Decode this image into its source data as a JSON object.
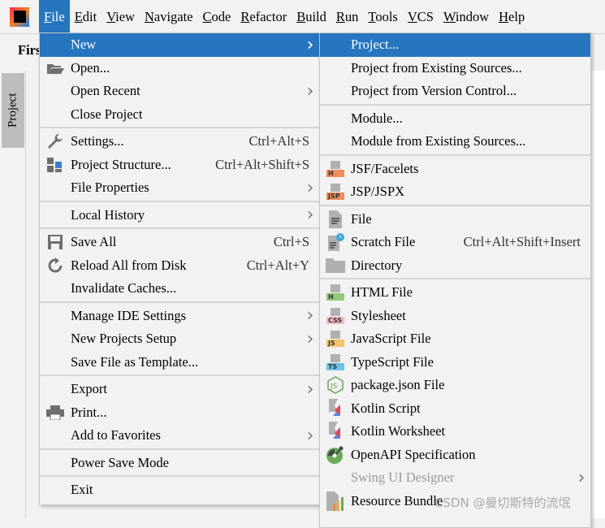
{
  "menubar": {
    "items": [
      "File",
      "Edit",
      "View",
      "Navigate",
      "Code",
      "Refactor",
      "Build",
      "Run",
      "Tools",
      "VCS",
      "Window",
      "Help"
    ],
    "active": "File"
  },
  "breadcrumb": "Firs",
  "tool_window": {
    "project_tab": "Project"
  },
  "file_menu": [
    {
      "label": "New",
      "arrow": true,
      "selected": true
    },
    {
      "label": "Open...",
      "icon": "folder-open-icon"
    },
    {
      "label": "Open Recent",
      "arrow": true
    },
    {
      "label": "Close Project"
    },
    {
      "sep": true
    },
    {
      "label": "Settings...",
      "icon": "wrench-icon",
      "shortcut": "Ctrl+Alt+S"
    },
    {
      "label": "Project Structure...",
      "icon": "project-structure-icon",
      "shortcut": "Ctrl+Alt+Shift+S"
    },
    {
      "label": "File Properties",
      "arrow": true
    },
    {
      "sep": true
    },
    {
      "label": "Local History",
      "arrow": true
    },
    {
      "sep": true
    },
    {
      "label": "Save All",
      "icon": "save-icon",
      "shortcut": "Ctrl+S"
    },
    {
      "label": "Reload All from Disk",
      "icon": "reload-icon",
      "shortcut": "Ctrl+Alt+Y"
    },
    {
      "label": "Invalidate Caches..."
    },
    {
      "sep": true
    },
    {
      "label": "Manage IDE Settings",
      "arrow": true
    },
    {
      "label": "New Projects Setup",
      "arrow": true
    },
    {
      "label": "Save File as Template..."
    },
    {
      "sep": true
    },
    {
      "label": "Export",
      "arrow": true
    },
    {
      "label": "Print...",
      "icon": "printer-icon"
    },
    {
      "label": "Add to Favorites",
      "arrow": true
    },
    {
      "sep": true
    },
    {
      "label": "Power Save Mode"
    },
    {
      "sep": true
    },
    {
      "label": "Exit"
    }
  ],
  "new_submenu": [
    {
      "label": "Project...",
      "selected": true
    },
    {
      "label": "Project from Existing Sources..."
    },
    {
      "label": "Project from Version Control..."
    },
    {
      "sep": true
    },
    {
      "label": "Module..."
    },
    {
      "label": "Module from Existing Sources..."
    },
    {
      "sep": true
    },
    {
      "label": "JSF/Facelets",
      "icon": "jsf-file-icon",
      "badge": "H",
      "badge_color": "#f28c5c"
    },
    {
      "label": "JSP/JSPX",
      "icon": "jsp-file-icon",
      "badge": "JSP",
      "badge_color": "#f28c5c"
    },
    {
      "sep": true
    },
    {
      "label": "File",
      "icon": "file-icon"
    },
    {
      "label": "Scratch File",
      "icon": "scratch-file-icon",
      "shortcut": "Ctrl+Alt+Shift+Insert"
    },
    {
      "label": "Directory",
      "icon": "directory-icon"
    },
    {
      "sep": true
    },
    {
      "label": "HTML File",
      "icon": "html-file-icon",
      "badge": "H",
      "badge_color": "#8fc97a"
    },
    {
      "label": "Stylesheet",
      "icon": "css-file-icon",
      "badge": "CSS",
      "badge_color": "#f5b8c4"
    },
    {
      "label": "JavaScript File",
      "icon": "js-file-icon",
      "badge": "JS",
      "badge_color": "#f5c46e"
    },
    {
      "label": "TypeScript File",
      "icon": "ts-file-icon",
      "badge": "TS",
      "badge_color": "#6cc4ea"
    },
    {
      "label": "package.json File",
      "icon": "nodejs-icon"
    },
    {
      "label": "Kotlin Script",
      "icon": "kotlin-icon"
    },
    {
      "label": "Kotlin Worksheet",
      "icon": "kotlin-icon"
    },
    {
      "label": "OpenAPI Specification",
      "icon": "openapi-icon"
    },
    {
      "label": "Swing UI Designer",
      "arrow": true,
      "disabled": true
    },
    {
      "label": "Resource Bundle",
      "icon": "resource-bundle-icon"
    }
  ],
  "watermark": "CSDN @曼切斯特的流氓",
  "colors": {
    "accent": "#2675bf",
    "menu_bg": "#f2f2f2"
  }
}
